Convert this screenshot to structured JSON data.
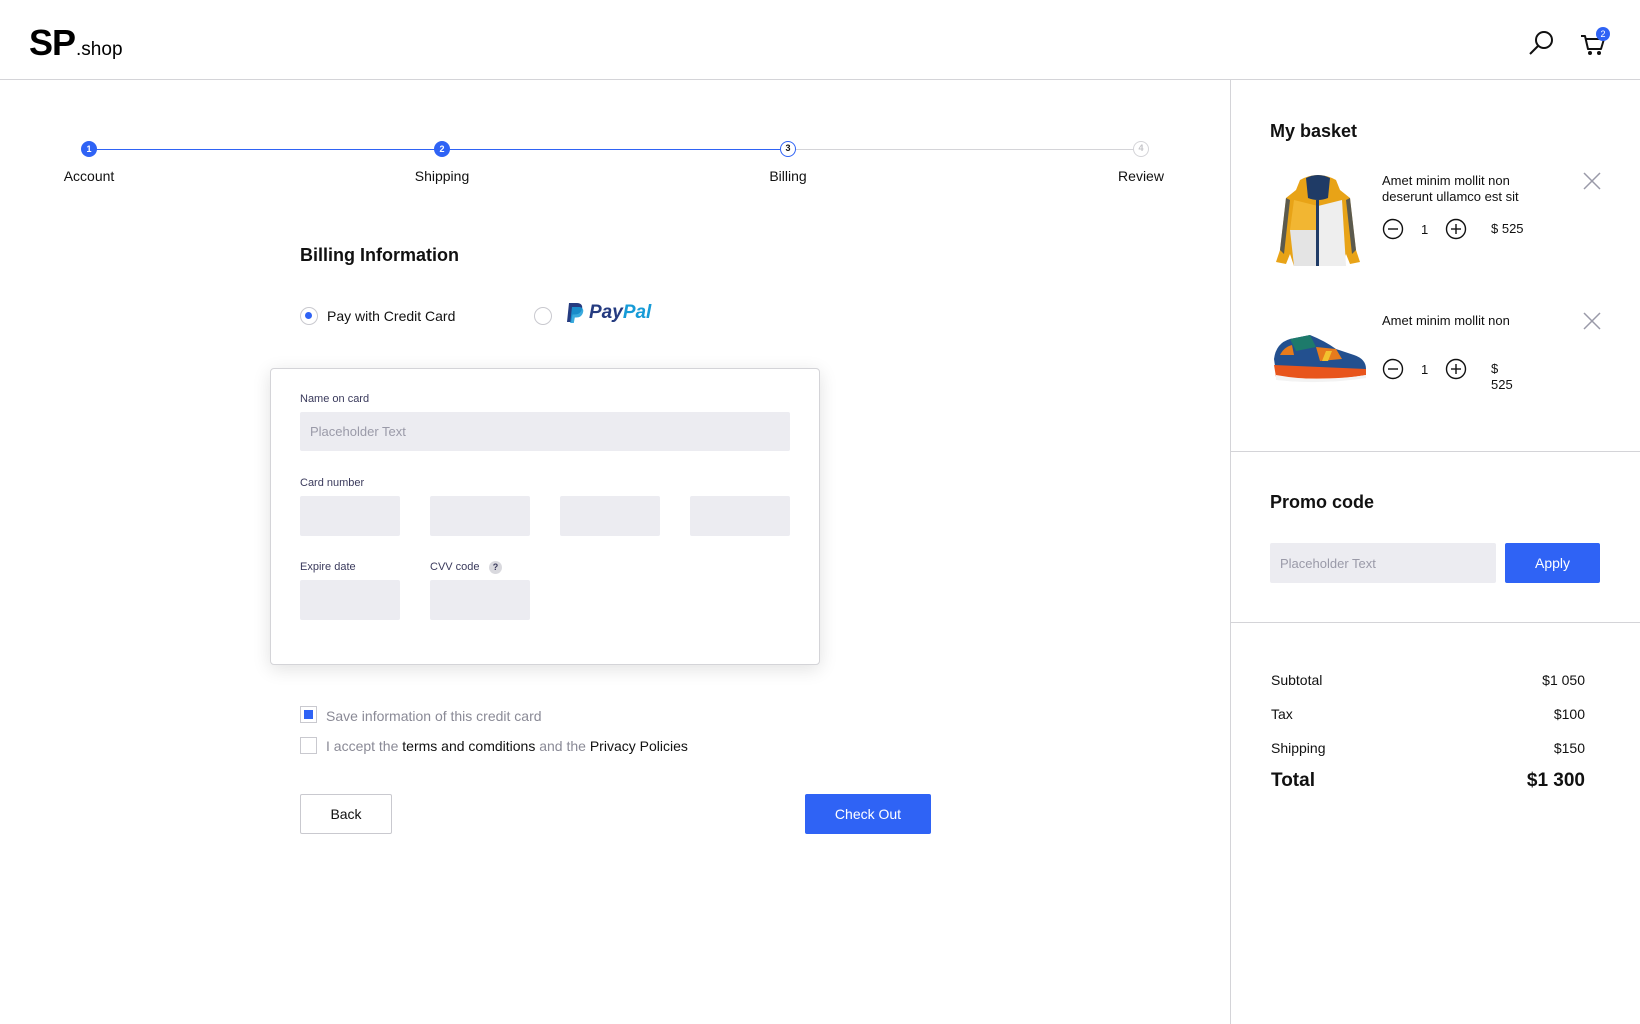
{
  "header": {
    "logo_main": "SP",
    "logo_suffix": ".shop",
    "search_icon": "search-icon",
    "cart_icon": "cart-icon",
    "cart_count": "2"
  },
  "colors": {
    "accent": "#2f63f5",
    "field_bg": "#ececf1",
    "border": "#d4d4d8"
  },
  "stepper": {
    "steps": [
      {
        "number": "1",
        "label": "Account",
        "state": "done"
      },
      {
        "number": "2",
        "label": "Shipping",
        "state": "done"
      },
      {
        "number": "3",
        "label": "Billing",
        "state": "current"
      },
      {
        "number": "4",
        "label": "Review",
        "state": "todo"
      }
    ]
  },
  "billing": {
    "title": "Billing Information",
    "option_card": "Pay with Credit Card",
    "option_paypal_a": "Pay",
    "option_paypal_b": "Pal",
    "name_label": "Name on card",
    "name_placeholder": "Placeholder Text",
    "card_number_label": "Card number",
    "expire_label": "Expire date",
    "cvv_label": "CVV code",
    "cvv_help": "?",
    "save_info": "Save information of this credit card",
    "accept_prefix": "I accept the",
    "terms_link": "terms and comditions",
    "accept_mid": "and the",
    "privacy_link": "Privacy Policies",
    "back_label": "Back",
    "checkout_label": "Check Out"
  },
  "basket": {
    "title": "My basket",
    "items": [
      {
        "name": "Amet minim mollit non deserunt ullamco est sit",
        "qty": "1",
        "price": "$ 525",
        "image": "yellow-jacket"
      },
      {
        "name": "Amet minim mollit non",
        "qty": "1",
        "price": "$ 525",
        "image": "sneaker"
      }
    ]
  },
  "promo": {
    "title": "Promo code",
    "placeholder": "Placeholder Text",
    "apply_label": "Apply"
  },
  "summary": {
    "subtotal_label": "Subtotal",
    "subtotal_value": "$1 050",
    "tax_label": "Tax",
    "tax_value": "$100",
    "shipping_label": "Shipping",
    "shipping_value": "$150",
    "total_label": "Total",
    "total_value": "$1 300"
  }
}
